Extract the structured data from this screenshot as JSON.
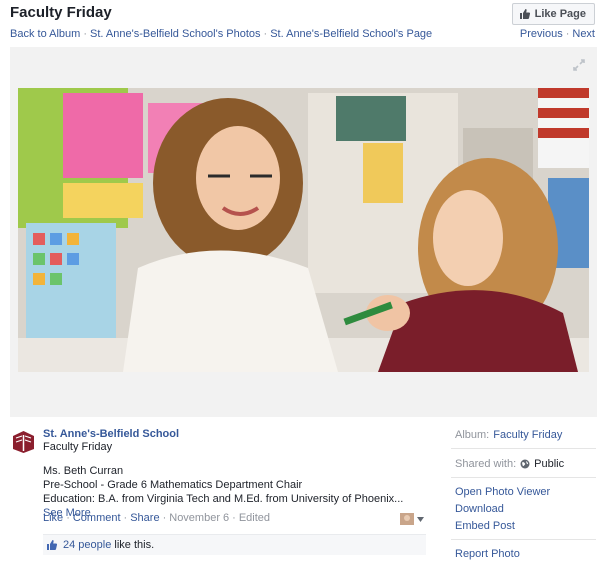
{
  "header": {
    "title": "Faculty Friday",
    "like_page_label": "Like Page"
  },
  "nav": {
    "back_to_album": "Back to Album",
    "photos_link": "St. Anne's-Belfield School's Photos",
    "page_link": "St. Anne's-Belfield School's Page",
    "previous": "Previous",
    "next": "Next"
  },
  "post": {
    "page_name": "St. Anne's-Belfield School",
    "album": "Faculty Friday",
    "caption_lines": [
      "Ms. Beth Curran",
      "Pre-School - Grade 6 Mathematics Department Chair",
      "Education: B.A. from Virginia Tech and M.Ed. from University of Phoenix..."
    ],
    "see_more": "See More",
    "actions": {
      "like": "Like",
      "comment": "Comment",
      "share": "Share",
      "date": "November 6",
      "edited": "Edited"
    },
    "likes_count": "24 people",
    "likes_suffix": "like this."
  },
  "sidebar": {
    "album_label": "Album:",
    "album_value": "Faculty Friday",
    "shared_label": "Shared with:",
    "shared_value": "Public",
    "links": [
      "Open Photo Viewer",
      "Download",
      "Embed Post",
      "Report Photo"
    ]
  },
  "colors": {
    "link": "#365899",
    "muted": "#90949c",
    "stage_bg": "#f2f2f2",
    "school_logo": "#8b1f2e"
  },
  "icons": {
    "like_button": "thumbs-up-icon",
    "fullscreen": "fullscreen-icon",
    "audience": "globe-icon",
    "likes_bar": "thumbs-up-icon"
  }
}
